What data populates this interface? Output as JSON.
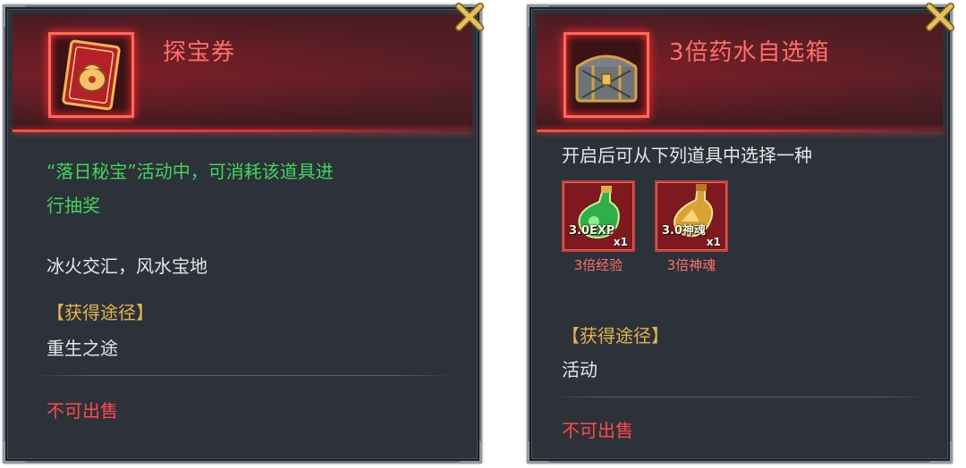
{
  "colors": {
    "title_red": "#ff6f66",
    "highlight_green": "#3fd65a",
    "gold": "#e2b44a",
    "warning_red": "#ff4a4a",
    "panel_bg": "#2c313a"
  },
  "left_panel": {
    "title": "探宝券",
    "item_icon": "red-scroll-bag-icon",
    "event_desc_line1": "“落日秘宝”活动中，可消耗该道具进",
    "event_desc_line2": "行抽奖",
    "flavor_text": "冰火交汇，风水宝地",
    "source_header": "【获得途径】",
    "source": "重生之途",
    "sell_status": "不可出售",
    "close_icon": "close-x-icon"
  },
  "right_panel": {
    "title": "3倍药水自选箱",
    "item_icon": "treasure-chest-icon",
    "description": "开启后可从下列道具中选择一种",
    "choices": [
      {
        "badge": "3.0EXP",
        "quantity": "x1",
        "name": "3倍经验",
        "icon": "green-potion-icon"
      },
      {
        "badge": "3.0神魂",
        "quantity": "x1",
        "name": "3倍神魂",
        "icon": "gold-potion-icon"
      }
    ],
    "source_header": "【获得途径】",
    "source": "活动",
    "sell_status": "不可出售",
    "close_icon": "close-x-icon"
  }
}
